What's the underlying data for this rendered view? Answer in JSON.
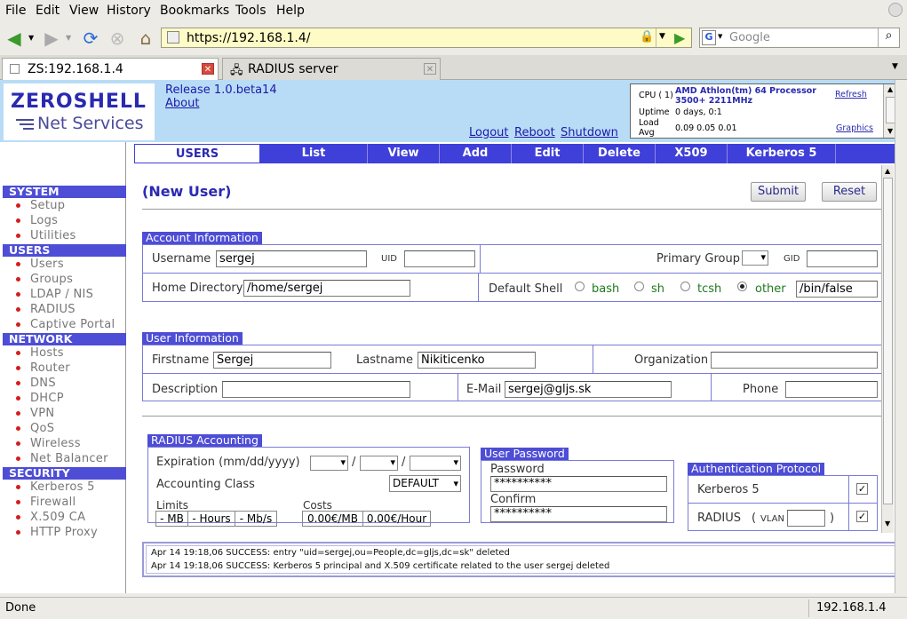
{
  "browser": {
    "menu": [
      "File",
      "Edit",
      "View",
      "History",
      "Bookmarks",
      "Tools",
      "Help"
    ],
    "url": "https://192.168.1.4/",
    "search_placeholder": "Google",
    "tabs": [
      {
        "label": "ZS:192.168.1.4"
      },
      {
        "label": "RADIUS server"
      }
    ],
    "status": "Done",
    "status_host": "192.168.1.4"
  },
  "header": {
    "logo_top": "ZEROSHELL",
    "logo_bottom": "Net Services",
    "release": "Release 1.0.beta14",
    "about": "About",
    "logout": "Logout",
    "reboot": "Reboot",
    "shutdown": "Shutdown",
    "cpu_label": "CPU ( 1)",
    "cpu_value": "AMD Athlon(tm) 64 Processor 3500+ 2211MHz",
    "refresh": "Refresh",
    "uptime_label": "Uptime",
    "uptime_value": "0 days, 0:1",
    "load_label": "Load Avg",
    "load_value": "0.09 0.05 0.01",
    "graphics": "Graphics"
  },
  "sidebar": {
    "system": {
      "title": "SYSTEM",
      "items": [
        "Setup",
        "Logs",
        "Utilities"
      ]
    },
    "users": {
      "title": "USERS",
      "items": [
        "Users",
        "Groups",
        "LDAP / NIS",
        "RADIUS",
        "Captive Portal"
      ]
    },
    "network": {
      "title": "NETWORK",
      "items": [
        "Hosts",
        "Router",
        "DNS",
        "DHCP",
        "VPN",
        "QoS",
        "Wireless",
        "Net Balancer"
      ]
    },
    "security": {
      "title": "SECURITY",
      "items": [
        "Kerberos 5",
        "Firewall",
        "X.509 CA",
        "HTTP Proxy"
      ]
    }
  },
  "tabs": [
    "USERS",
    "List",
    "View",
    "Add",
    "Edit",
    "Delete",
    "X509",
    "Kerberos 5"
  ],
  "form": {
    "title": "(New User)",
    "submit": "Submit",
    "reset": "Reset",
    "account": {
      "legend": "Account Information",
      "username_label": "Username",
      "username": "sergej",
      "uid_label": "UID",
      "uid": "",
      "primary_group_label": "Primary Group",
      "gid_label": "GID",
      "gid": "",
      "home_label": "Home Directory",
      "home": "/home/sergej",
      "shell_label": "Default Shell",
      "shells": [
        "bash",
        "sh",
        "tcsh",
        "other"
      ],
      "shell_selected": "other",
      "other_shell": "/bin/false"
    },
    "user": {
      "legend": "User Information",
      "firstname_label": "Firstname",
      "firstname": "Sergej",
      "lastname_label": "Lastname",
      "lastname": "Nikiticenko",
      "org_label": "Organization",
      "org": "",
      "desc_label": "Description",
      "desc": "",
      "email_label": "E-Mail",
      "email": "sergej@gljs.sk",
      "phone_label": "Phone",
      "phone": ""
    },
    "radius": {
      "legend": "RADIUS Accounting",
      "expiration_label": "Expiration (mm/dd/yyyy)",
      "sep": "/",
      "class_label": "Accounting Class",
      "class": "DEFAULT",
      "limits_label": "Limits",
      "limits": [
        "- MB",
        "- Hours",
        "- Mb/s"
      ],
      "costs_label": "Costs",
      "costs": [
        "0.00€/MB",
        "0.00€/Hour"
      ]
    },
    "password": {
      "legend": "User Password",
      "password_label": "Password",
      "password": "**********",
      "confirm_label": "Confirm",
      "confirm": "**********"
    },
    "auth": {
      "legend": "Authentication Protocol",
      "kerberos": "Kerberos 5",
      "radius": "RADIUS",
      "vlan_open": "(",
      "vlan_label": "VLAN",
      "vlan_close": ")",
      "vlan": ""
    },
    "log": [
      "Apr 14 19:18,06 SUCCESS: entry \"uid=sergej,ou=People,dc=gljs,dc=sk\" deleted",
      "Apr 14 19:18,06 SUCCESS: Kerberos 5 principal and X.509 certificate related to the user sergej deleted"
    ]
  }
}
